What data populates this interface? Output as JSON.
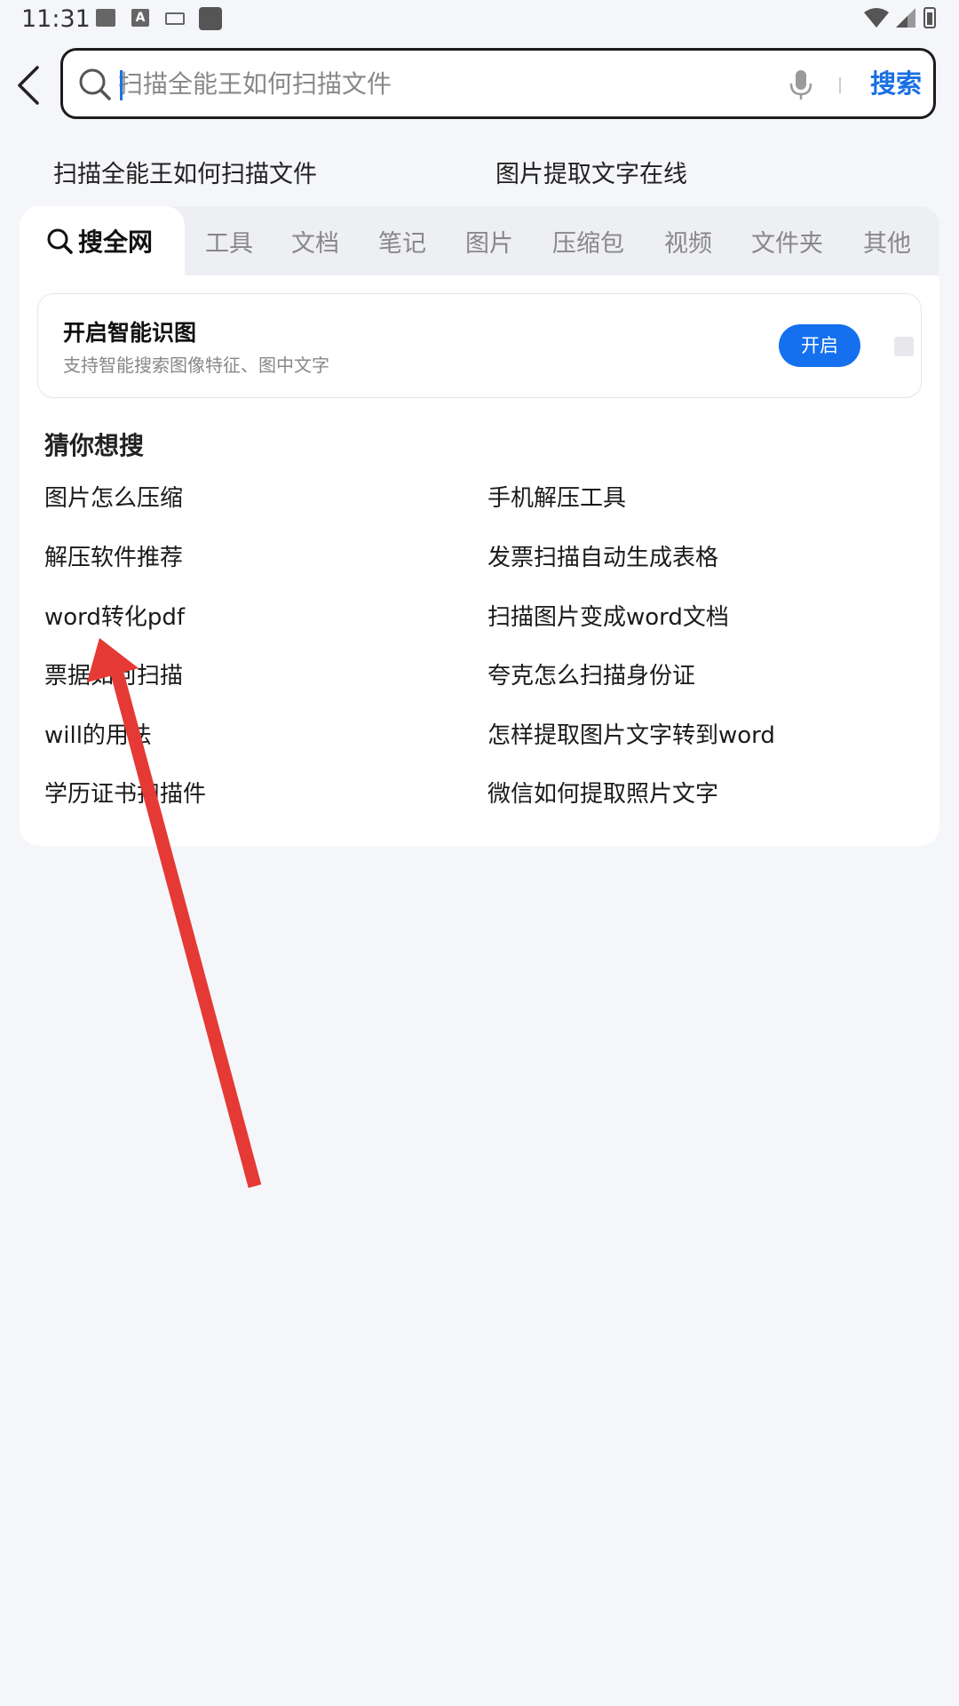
{
  "status_bar": {
    "time": "11:31",
    "a_icon_letter": "A"
  },
  "search": {
    "placeholder": "扫描全能王如何扫描文件",
    "button_label": "搜索"
  },
  "history": [
    "扫描全能王如何扫描文件",
    "图片提取文字在线"
  ],
  "tabs": {
    "active": "搜全网",
    "items": [
      "工具",
      "文档",
      "笔记",
      "图片",
      "压缩包",
      "视频",
      "文件夹",
      "其他"
    ]
  },
  "smart_recognition": {
    "title": "开启智能识图",
    "subtitle": "支持智能搜索图像特征、图中文字",
    "button_label": "开启"
  },
  "guess": {
    "title": "猜你想搜",
    "left": [
      "图片怎么压缩",
      "解压软件推荐",
      "word转化pdf",
      "票据如何扫描",
      "will的用法",
      "学历证书扫描件"
    ],
    "right": [
      "手机解压工具",
      "发票扫描自动生成表格",
      "扫描图片变成word文档",
      "夸克怎么扫描身份证",
      "怎样提取图片文字转到word",
      "微信如何提取照片文字"
    ]
  },
  "colors": {
    "accent": "#1570ef",
    "search_text": "#1a6fe3",
    "annotation_arrow": "#e53935"
  }
}
